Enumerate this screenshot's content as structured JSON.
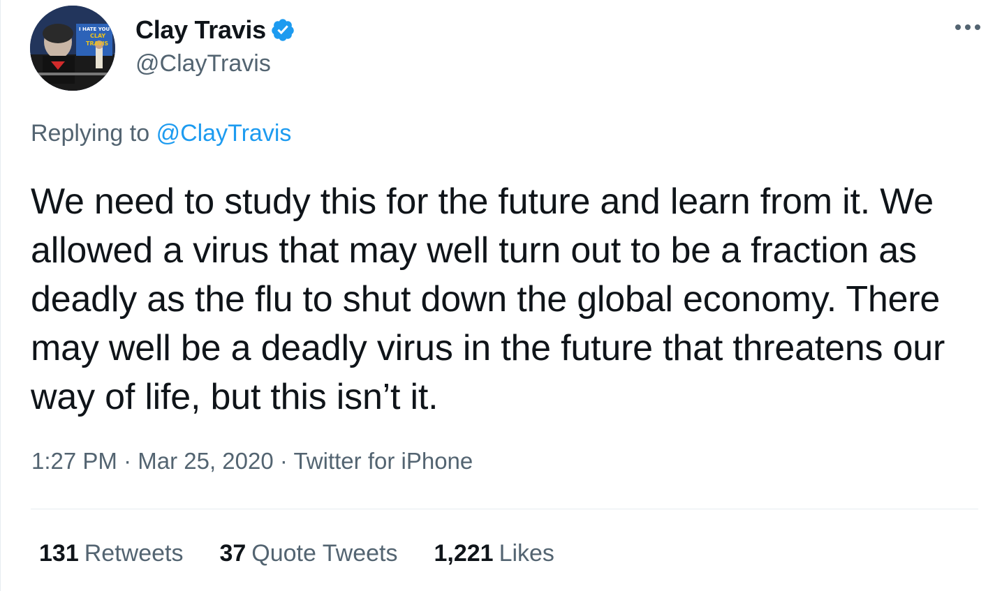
{
  "author": {
    "display_name": "Clay Travis",
    "handle": "@ClayTravis",
    "verified": true,
    "avatar_sign_text": "I HATE YOU CLAY TRAVIS"
  },
  "reply": {
    "prefix": "Replying to",
    "mention": "@ClayTravis"
  },
  "tweet": {
    "text": "We need to study this for the future and learn from it. We allowed a virus that may well turn out to be a fraction as deadly as the flu to shut down the global economy. There may well be a deadly virus in the future that threatens our way of life, but this isn’t it."
  },
  "meta": {
    "time": "1:27 PM",
    "separator": "·",
    "date": "Mar 25, 2020",
    "source": "Twitter for iPhone"
  },
  "stats": {
    "retweets_count": "131",
    "retweets_label": "Retweets",
    "quotes_count": "37",
    "quotes_label": "Quote Tweets",
    "likes_count": "1,221",
    "likes_label": "Likes"
  },
  "icons": {
    "verified": "verified-badge-icon",
    "more": "more-options-icon"
  },
  "colors": {
    "text_primary": "#0f1419",
    "text_secondary": "#536471",
    "accent": "#1d9bf0",
    "divider": "#e6ecf0"
  }
}
